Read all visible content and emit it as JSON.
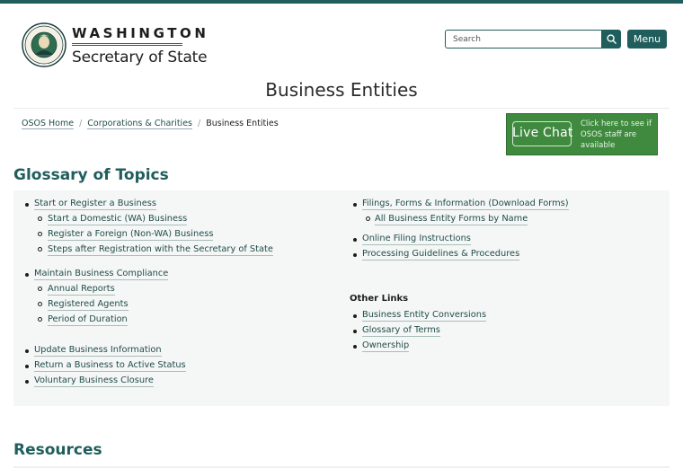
{
  "header": {
    "brand_title": "WASHINGTON",
    "brand_subtitle": "Secretary of State",
    "search_placeholder": "Search",
    "menu_label": "Menu",
    "accent_color": "#1f5e5c"
  },
  "page": {
    "title": "Business Entities"
  },
  "breadcrumbs": [
    "OSOS Home",
    "Corporations & Charities",
    "Business Entities"
  ],
  "live_chat": {
    "title": "Live Chat",
    "text": "Click here to see if OSOS staff are available",
    "color": "#3f8a3f"
  },
  "glossary": {
    "heading": "Glossary of Topics",
    "left": {
      "group1": {
        "main": "Start or Register a Business",
        "subs": [
          "Start a Domestic (WA) Business",
          "Register a Foreign (Non-WA) Business",
          "Steps after Registration with the Secretary of State"
        ]
      },
      "group2": {
        "main": "Maintain Business Compliance",
        "subs": [
          "Annual Reports",
          "Registered Agents",
          "Period of Duration"
        ]
      },
      "group3": [
        "Update Business Information",
        "Return a Business to Active Status",
        "Voluntary Business Closure"
      ]
    },
    "right": {
      "filings": {
        "main": "Filings, Forms & Information (Download Forms)",
        "subs": [
          "All Business Entity Forms by Name"
        ]
      },
      "more": [
        "Online Filing Instructions",
        "Processing Guidelines & Procedures"
      ],
      "other_links_heading": "Other Links",
      "other_links": [
        "Business Entity Conversions",
        "Glossary of Terms",
        "Ownership"
      ]
    }
  },
  "resources": {
    "heading": "Resources"
  }
}
